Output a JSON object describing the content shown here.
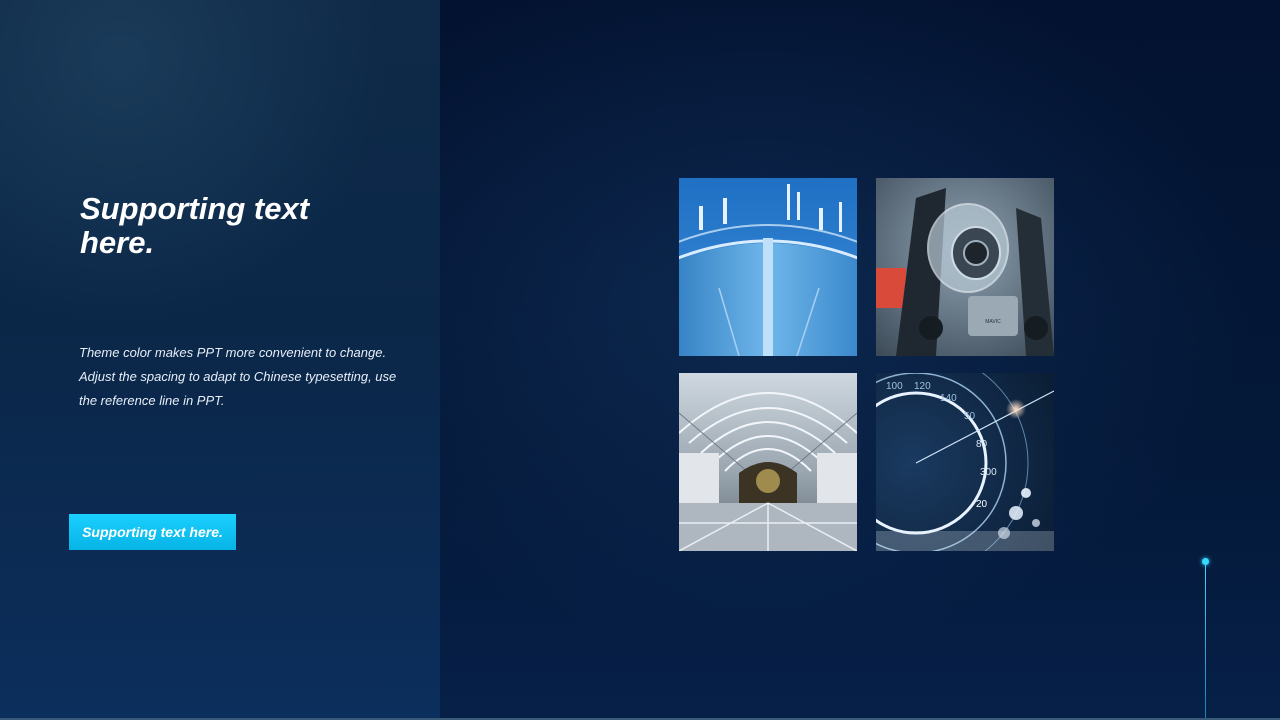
{
  "slide": {
    "title": "Supporting text here.",
    "body_lines": [
      "Theme  color makes PPT more convenient to change.",
      "Adjust the spacing to adapt to Chinese typesetting, use the reference line in PPT."
    ],
    "button_label": "Supporting text here."
  },
  "images": [
    {
      "name": "water-tower-photo",
      "dial_labels": []
    },
    {
      "name": "drone-camera-photo",
      "logo_text": "MAVIC"
    },
    {
      "name": "glass-hall-photo"
    },
    {
      "name": "speedometer-photo",
      "dial_labels": [
        "100",
        "120",
        "140",
        "50",
        "80",
        "300",
        "20"
      ]
    }
  ],
  "colors": {
    "accent": "#0fc4f5",
    "accent_line": "#39d8ff",
    "text": "#ffffff"
  }
}
